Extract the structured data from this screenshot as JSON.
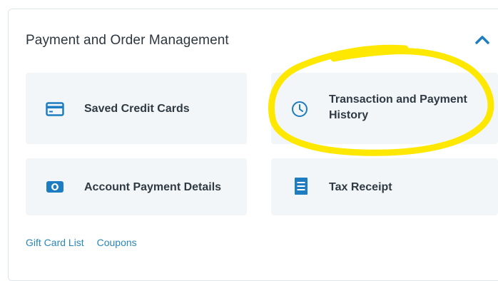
{
  "section": {
    "title": "Payment and Order Management",
    "collapse_icon": "chevron-up-icon"
  },
  "cards": [
    {
      "label": "Saved Credit Cards",
      "icon": "credit-card-icon"
    },
    {
      "label": "Transaction and Payment History",
      "icon": "clock-icon"
    },
    {
      "label": "Account Payment Details",
      "icon": "cash-icon"
    },
    {
      "label": "Tax Receipt",
      "icon": "receipt-icon"
    }
  ],
  "links": [
    "Gift Card List",
    "Coupons"
  ],
  "colors": {
    "accent": "#1e7cc0",
    "card_bg": "#f2f6f8",
    "link": "#2a86b8",
    "highlight": "#ffe800"
  }
}
